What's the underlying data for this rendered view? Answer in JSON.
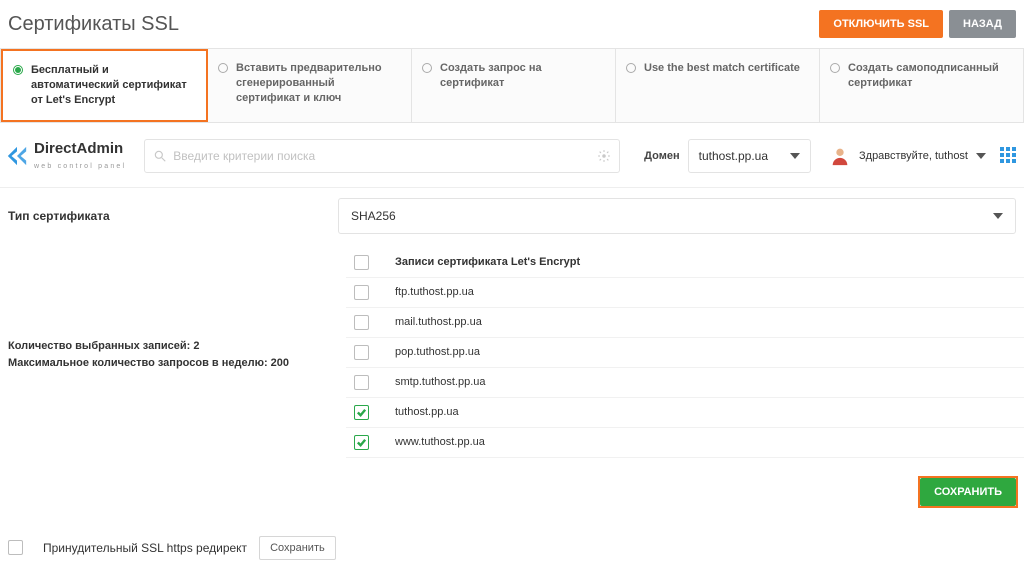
{
  "page": {
    "title": "Сертификаты SSL"
  },
  "header_buttons": {
    "disable_ssl": "ОТКЛЮЧИТЬ SSL",
    "back": "НАЗАД"
  },
  "tabs": [
    {
      "label": "Бесплатный и автоматический сертификат от Let's Encrypt"
    },
    {
      "label": "Вставить предварительно сгенерированный сертификат и ключ"
    },
    {
      "label": "Создать запрос на сертификат"
    },
    {
      "label": "Use the best match certificate"
    },
    {
      "label": "Создать самоподписанный сертификат"
    }
  ],
  "logo": {
    "name": "DirectAdmin",
    "subtitle": "web control panel"
  },
  "search": {
    "placeholder": "Введите критерии поиска"
  },
  "domain": {
    "label": "Домен",
    "value": "tuthost.pp.ua"
  },
  "user": {
    "greeting": "Здравствуйте,",
    "name": "tuthost"
  },
  "cert_type": {
    "label": "Тип сертификата",
    "value": "SHA256"
  },
  "records": {
    "header": "Записи сертификата Let's Encrypt",
    "side_line1": "Количество выбранных записей: 2",
    "side_line2": "Максимальное количество запросов в неделю: 200",
    "items": [
      {
        "host": "ftp.tuthost.pp.ua",
        "checked": false
      },
      {
        "host": "mail.tuthost.pp.ua",
        "checked": false
      },
      {
        "host": "pop.tuthost.pp.ua",
        "checked": false
      },
      {
        "host": "smtp.tuthost.pp.ua",
        "checked": false
      },
      {
        "host": "tuthost.pp.ua",
        "checked": true
      },
      {
        "host": "www.tuthost.pp.ua",
        "checked": true
      }
    ]
  },
  "actions": {
    "save": "СОХРАНИТЬ",
    "footer_save": "Сохранить"
  },
  "footer": {
    "force_https": "Принудительный SSL https редирект"
  }
}
